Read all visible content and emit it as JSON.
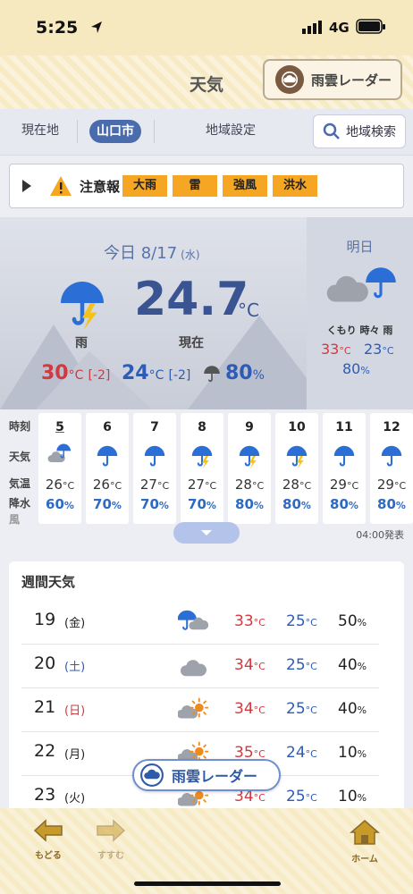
{
  "status": {
    "time": "5:25",
    "network": "4G"
  },
  "header": {
    "title": "天気",
    "radar_label": "雨雲レーダー"
  },
  "tabs": {
    "current": "現在地",
    "active": "山口市",
    "settings": "地域設定",
    "search": "地域検索"
  },
  "alert": {
    "label": "注意報",
    "items": [
      "大雨",
      "雷",
      "強風",
      "洪水"
    ]
  },
  "today": {
    "heading": "今日 8/17",
    "dow": "(水)",
    "condition": "雨",
    "temp": "24.7",
    "temp_unit": "°C",
    "now_label": "現在",
    "high": "30",
    "high_diff": "[-2]",
    "low": "24",
    "low_diff": "[-2]",
    "unit": "°C",
    "pop": "80",
    "pct": "%"
  },
  "tomorrow": {
    "heading": "明日",
    "condition": "くもり 時々 雨",
    "high": "33",
    "low": "23",
    "unit": "°C",
    "pop": "80",
    "pct": "%"
  },
  "hourly": {
    "labels": {
      "time": "時刻",
      "weather": "天気",
      "temp": "気温",
      "rain": "降水",
      "wind": "風"
    },
    "unit_t": "°C",
    "unit_p": "%",
    "hours": [
      {
        "h": "5",
        "t": "26",
        "p": "60",
        "icon": "cloud-umbrella-icon"
      },
      {
        "h": "6",
        "t": "26",
        "p": "70",
        "icon": "umbrella-icon"
      },
      {
        "h": "7",
        "t": "27",
        "p": "70",
        "icon": "umbrella-icon"
      },
      {
        "h": "8",
        "t": "27",
        "p": "70",
        "icon": "umbrella-thunder-icon"
      },
      {
        "h": "9",
        "t": "28",
        "p": "80",
        "icon": "umbrella-thunder-icon"
      },
      {
        "h": "10",
        "t": "28",
        "p": "80",
        "icon": "umbrella-thunder-icon"
      },
      {
        "h": "11",
        "t": "29",
        "p": "80",
        "icon": "umbrella-icon"
      },
      {
        "h": "12",
        "t": "29",
        "p": "80",
        "icon": "umbrella-icon"
      }
    ],
    "issued": "04:00発表"
  },
  "weekly": {
    "title": "週間天気",
    "unit_t": "°C",
    "unit_p": "%",
    "days": [
      {
        "d": "19",
        "w": "(金)",
        "hi": "33",
        "lo": "25",
        "p": "50",
        "icon": "umbrella-cloud-icon",
        "wcolor": "#222"
      },
      {
        "d": "20",
        "w": "(土)",
        "hi": "34",
        "lo": "25",
        "p": "40",
        "icon": "cloud-icon",
        "wcolor": "#2d5bb6"
      },
      {
        "d": "21",
        "w": "(日)",
        "hi": "34",
        "lo": "25",
        "p": "40",
        "icon": "cloud-sun-icon",
        "wcolor": "#d2383f"
      },
      {
        "d": "22",
        "w": "(月)",
        "hi": "35",
        "lo": "24",
        "p": "10",
        "icon": "cloud-sun-icon",
        "wcolor": "#222"
      },
      {
        "d": "23",
        "w": "(火)",
        "hi": "34",
        "lo": "25",
        "p": "10",
        "icon": "cloud-sun-icon",
        "wcolor": "#222"
      }
    ]
  },
  "float_radar": "雨雲レーダー",
  "nav": {
    "back": "もどる",
    "forward": "すすむ",
    "home": "ホーム"
  },
  "colors": {
    "accent": "#4a6cad",
    "high": "#d2383f",
    "low": "#2d5bb6",
    "warning": "#f5a623"
  }
}
